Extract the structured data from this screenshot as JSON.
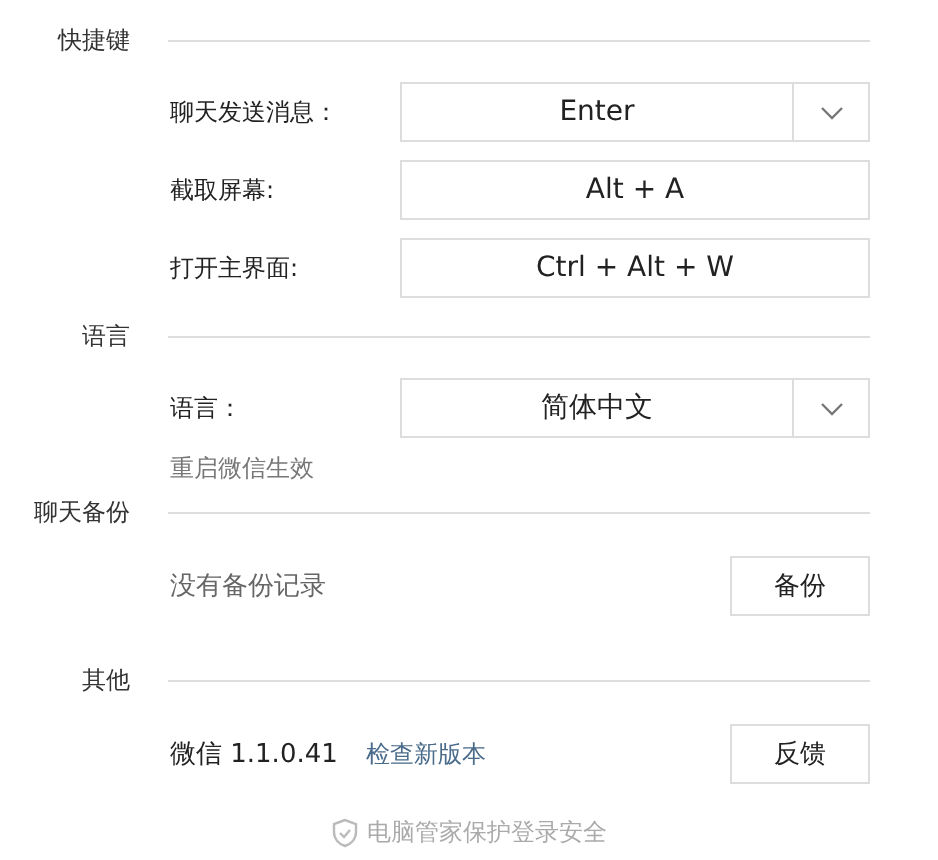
{
  "sections": [
    {
      "title": "快捷键",
      "rows": [
        {
          "kind": "select",
          "label": "聊天发送消息：",
          "value": "Enter"
        },
        {
          "kind": "input",
          "label": "截取屏幕:",
          "value": "Alt + A"
        },
        {
          "kind": "input",
          "label": "打开主界面:",
          "value": "Ctrl + Alt + W"
        }
      ]
    },
    {
      "title": "语言",
      "rows": [
        {
          "kind": "select",
          "label": "语言：",
          "value": "简体中文"
        },
        {
          "kind": "note",
          "text": "重启微信生效"
        }
      ]
    },
    {
      "title": "聊天备份",
      "rows": [
        {
          "kind": "action",
          "text": "没有备份记录",
          "button": "备份"
        }
      ]
    },
    {
      "title": "其他",
      "rows": [
        {
          "kind": "version",
          "text": "微信 1.1.0.41",
          "link": "检查新版本",
          "button": "反馈"
        }
      ]
    }
  ],
  "footer": "电脑管家保护登录安全"
}
